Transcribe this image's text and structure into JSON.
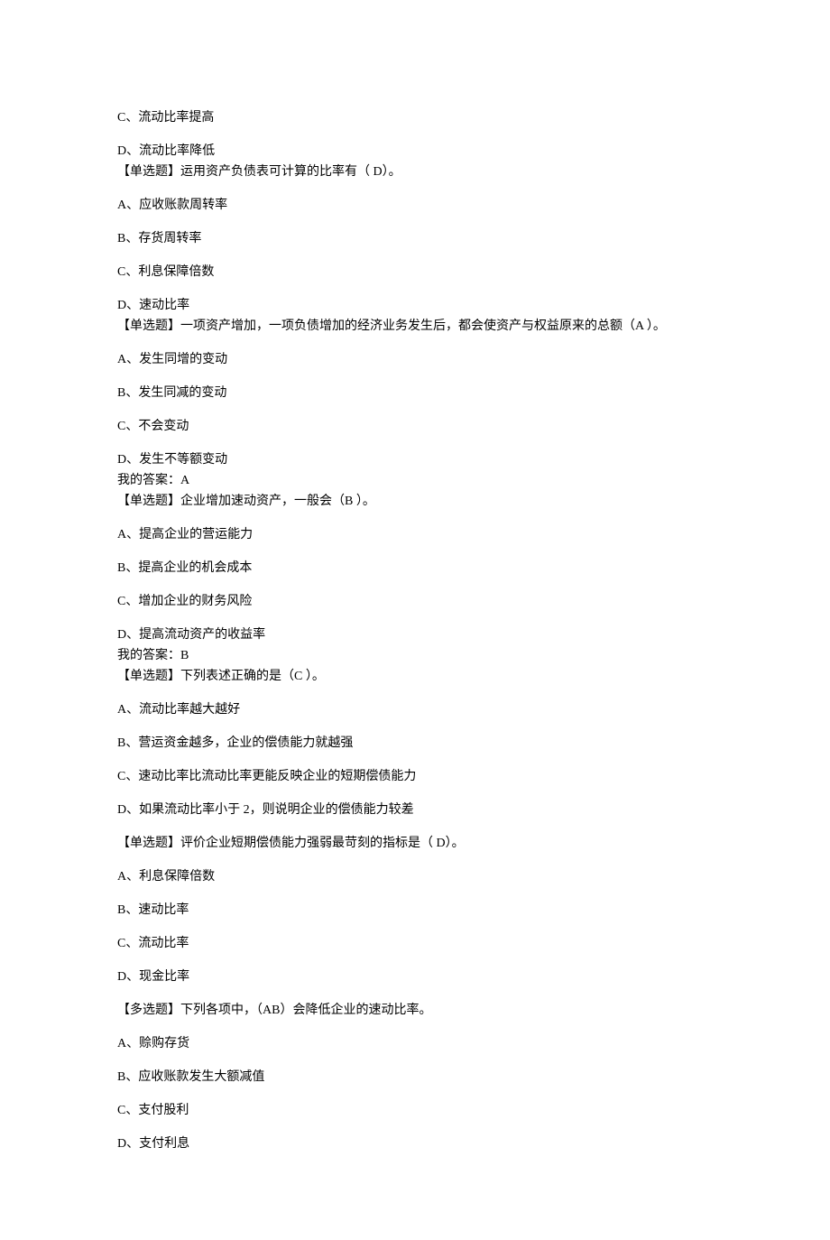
{
  "lines": [
    {
      "text": "C、流动比率提高",
      "cls": "option"
    },
    {
      "text": "D、流动比率降低",
      "cls": "tight"
    },
    {
      "text": "【单选题】运用资产负债表可计算的比率有（ D）。",
      "cls": "block"
    },
    {
      "text": "A、应收账款周转率",
      "cls": "option"
    },
    {
      "text": "B、存货周转率",
      "cls": "option"
    },
    {
      "text": "C、利息保障倍数",
      "cls": "option"
    },
    {
      "text": "D、速动比率",
      "cls": "tight"
    },
    {
      "text": "【单选题】一项资产增加，一项负债增加的经济业务发生后，都会使资产与权益原来的总额（A ）。",
      "cls": "block"
    },
    {
      "text": "A、发生同增的变动",
      "cls": "option"
    },
    {
      "text": "B、发生同减的变动",
      "cls": "option"
    },
    {
      "text": "C、不会变动",
      "cls": "option"
    },
    {
      "text": "D、发生不等额变动",
      "cls": "tight"
    },
    {
      "text": "我的答案：A",
      "cls": "tight"
    },
    {
      "text": "【单选题】企业增加速动资产，一般会（B ）。",
      "cls": "block"
    },
    {
      "text": "A、提高企业的营运能力",
      "cls": "option"
    },
    {
      "text": "B、提高企业的机会成本",
      "cls": "option"
    },
    {
      "text": "C、增加企业的财务风险",
      "cls": "option"
    },
    {
      "text": "D、提高流动资产的收益率",
      "cls": "tight"
    },
    {
      "text": "我的答案：B",
      "cls": "tight"
    },
    {
      "text": "【单选题】下列表述正确的是（C ）。",
      "cls": "block"
    },
    {
      "text": "A、流动比率越大越好",
      "cls": "option"
    },
    {
      "text": "B、营运资金越多，企业的偿债能力就越强",
      "cls": "option"
    },
    {
      "text": "C、速动比率比流动比率更能反映企业的短期偿债能力",
      "cls": "option"
    },
    {
      "text": "D、如果流动比率小于 2，则说明企业的偿债能力较差",
      "cls": "option"
    },
    {
      "text": "【单选题】评价企业短期偿债能力强弱最苛刻的指标是（ D）。",
      "cls": "block"
    },
    {
      "text": "A、利息保障倍数",
      "cls": "option"
    },
    {
      "text": "B、速动比率",
      "cls": "option"
    },
    {
      "text": "C、流动比率",
      "cls": "option"
    },
    {
      "text": "D、现金比率",
      "cls": "option"
    },
    {
      "text": "【多选题】下列各项中，（AB）会降低企业的速动比率。",
      "cls": "block"
    },
    {
      "text": "A、赊购存货",
      "cls": "option"
    },
    {
      "text": "B、应收账款发生大额减值",
      "cls": "option"
    },
    {
      "text": "C、支付股利",
      "cls": "option"
    },
    {
      "text": "D、支付利息",
      "cls": "option"
    }
  ]
}
